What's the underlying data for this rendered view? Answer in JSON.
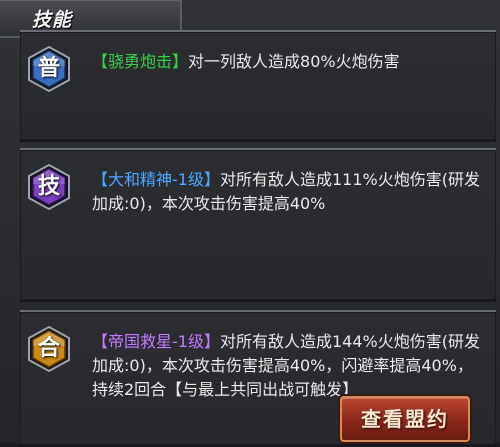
{
  "header": {
    "title": "技能"
  },
  "skills": [
    {
      "badge": "普",
      "name": "【骁勇炮击】",
      "description": "对一列敌人造成80%火炮伤害"
    },
    {
      "badge": "技",
      "name": "【大和精神-1级】",
      "description": "对所有敌人造成111%火炮伤害(研发加成:0)，本次攻击伤害提高40%"
    },
    {
      "badge": "合",
      "name": "【帝国救星-1级】",
      "description": "对所有敌人造成144%火炮伤害(研发加成:0)，本次攻击伤害提高40%，闪避率提高40%，持续2回合【与最上共同出战可触发】"
    }
  ],
  "actions": {
    "view_alliance_label": "查看盟约"
  },
  "colors": {
    "normal_badge": "#3a6fc4",
    "skill_badge": "#7a3fc0",
    "combo_badge": "#c98a16",
    "name_green": "#39d24a",
    "name_blue": "#4fa8ff",
    "name_purple": "#c47bff"
  }
}
